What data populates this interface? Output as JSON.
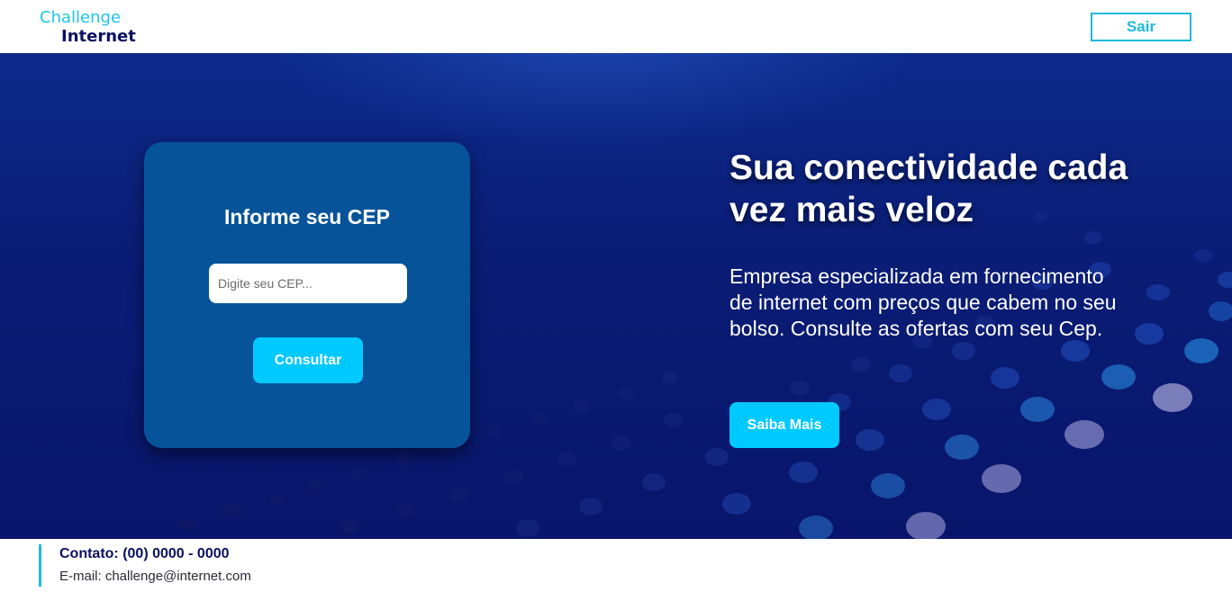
{
  "header": {
    "logo_line1": "Challenge",
    "logo_line2": "Internet",
    "logout_label": "Sair"
  },
  "cep_card": {
    "title": "Informe seu CEP",
    "input_placeholder": "Digite seu CEP...",
    "input_value": "",
    "submit_label": "Consultar"
  },
  "hero": {
    "title": "Sua conectividade cada vez mais veloz",
    "description": "Empresa especializada em fornecimento de internet com preços que cabem no seu bolso. Consulte as ofertas com seu Cep.",
    "cta_label": "Saiba Mais"
  },
  "footer": {
    "phone": "Contato: (00) 0000 - 0000",
    "email": "E-mail: challenge@internet.com"
  },
  "colors": {
    "accent": "#00c9ff",
    "brand_dark": "#0b1060",
    "hero_bg": "#0a1d76",
    "card_bg": "#06539a"
  }
}
